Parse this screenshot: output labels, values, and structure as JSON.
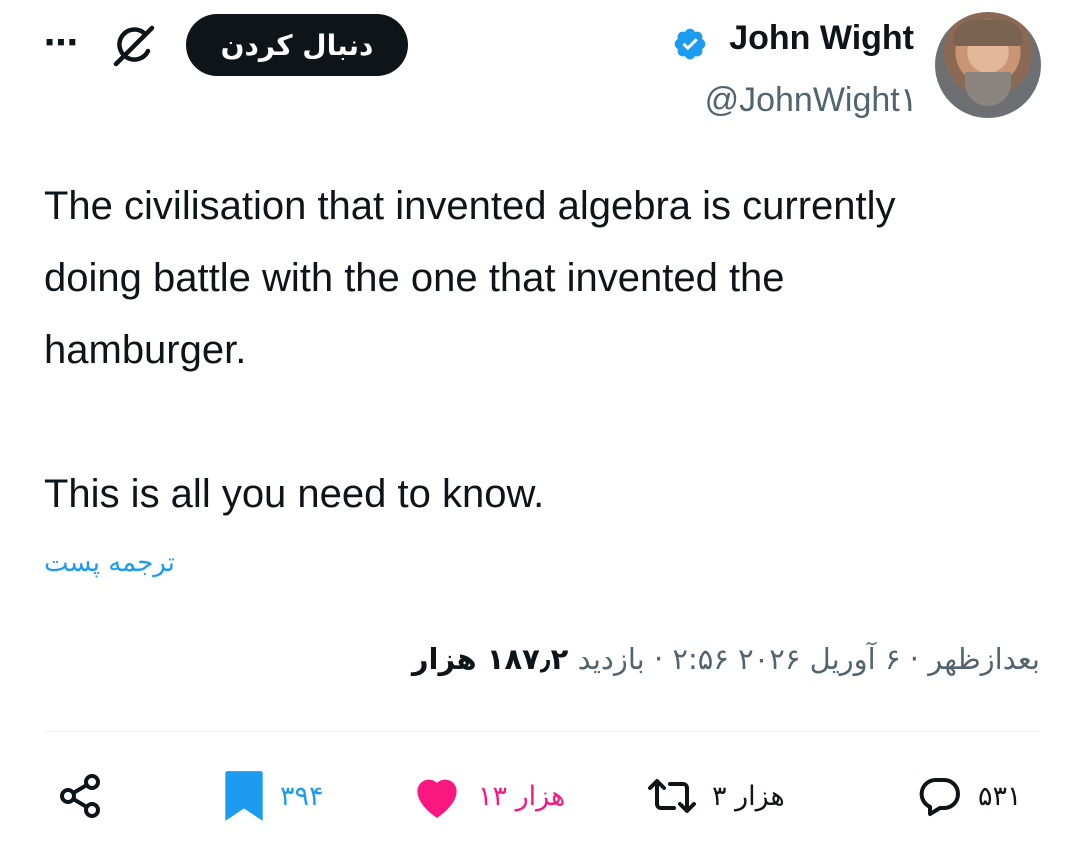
{
  "author": {
    "name": "John Wight",
    "handle": "@JohnWight۱",
    "avatar_icon": "avatar",
    "verified_icon": "verified-badge-icon"
  },
  "header": {
    "follow_label": "دنبال کردن",
    "grok_icon": "grok-icon",
    "more_label": "⋯"
  },
  "tweet": {
    "line1": "The civilisation that invented algebra is currently",
    "line2": "doing battle with the one that invented the",
    "line3": "hamburger.",
    "line4": "This is all you need to know."
  },
  "translate_label": "ترجمه پست",
  "meta": {
    "time": "بعدازظهر",
    "dot1": "·",
    "date": "۶ آوریل ۲۰۲۶ ۲:۵۶",
    "dot2": "·",
    "views_label": "بازدید",
    "views_count": "۱۸۷٫۲ هزار"
  },
  "actions": {
    "replies": "۵۳۱",
    "reposts": "۳ هزار",
    "likes": "۱۳ هزار",
    "bookmarks": "۳۹۴"
  },
  "colors": {
    "accent": "#1d9bf0",
    "like": "#f91880",
    "text": "#0f1419",
    "secondary": "#536471"
  }
}
